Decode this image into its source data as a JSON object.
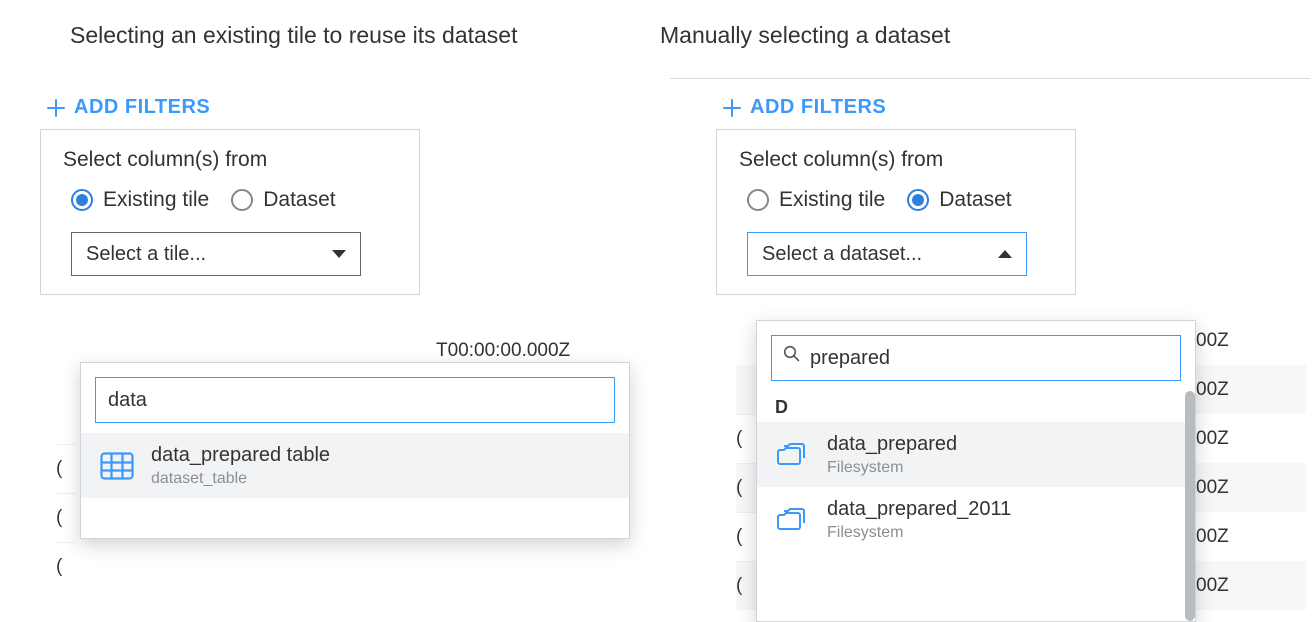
{
  "captions": {
    "left": "Selecting an existing tile to reuse its dataset",
    "right": "Manually selecting a dataset"
  },
  "addFiltersLabel": "ADD FILTERS",
  "popover": {
    "title": "Select column(s) from",
    "radioExisting": "Existing tile",
    "radioDataset": "Dataset"
  },
  "left": {
    "selectPlaceholder": "Select a tile...",
    "searchValue": "data",
    "result": {
      "title": "data_prepared table",
      "subtitle": "dataset_table"
    },
    "bgTimestamp": "T00:00:00.000Z"
  },
  "right": {
    "selectPlaceholder": "Select a dataset...",
    "searchValue": "prepared",
    "sectionLetter": "D",
    "results": [
      {
        "title": "data_prepared",
        "subtitle": "Filesystem"
      },
      {
        "title": "data_prepared_2011",
        "subtitle": "Filesystem"
      }
    ],
    "bgValues": [
      "00Z",
      "00Z",
      "00Z",
      "00Z",
      "00Z",
      "00Z"
    ]
  }
}
